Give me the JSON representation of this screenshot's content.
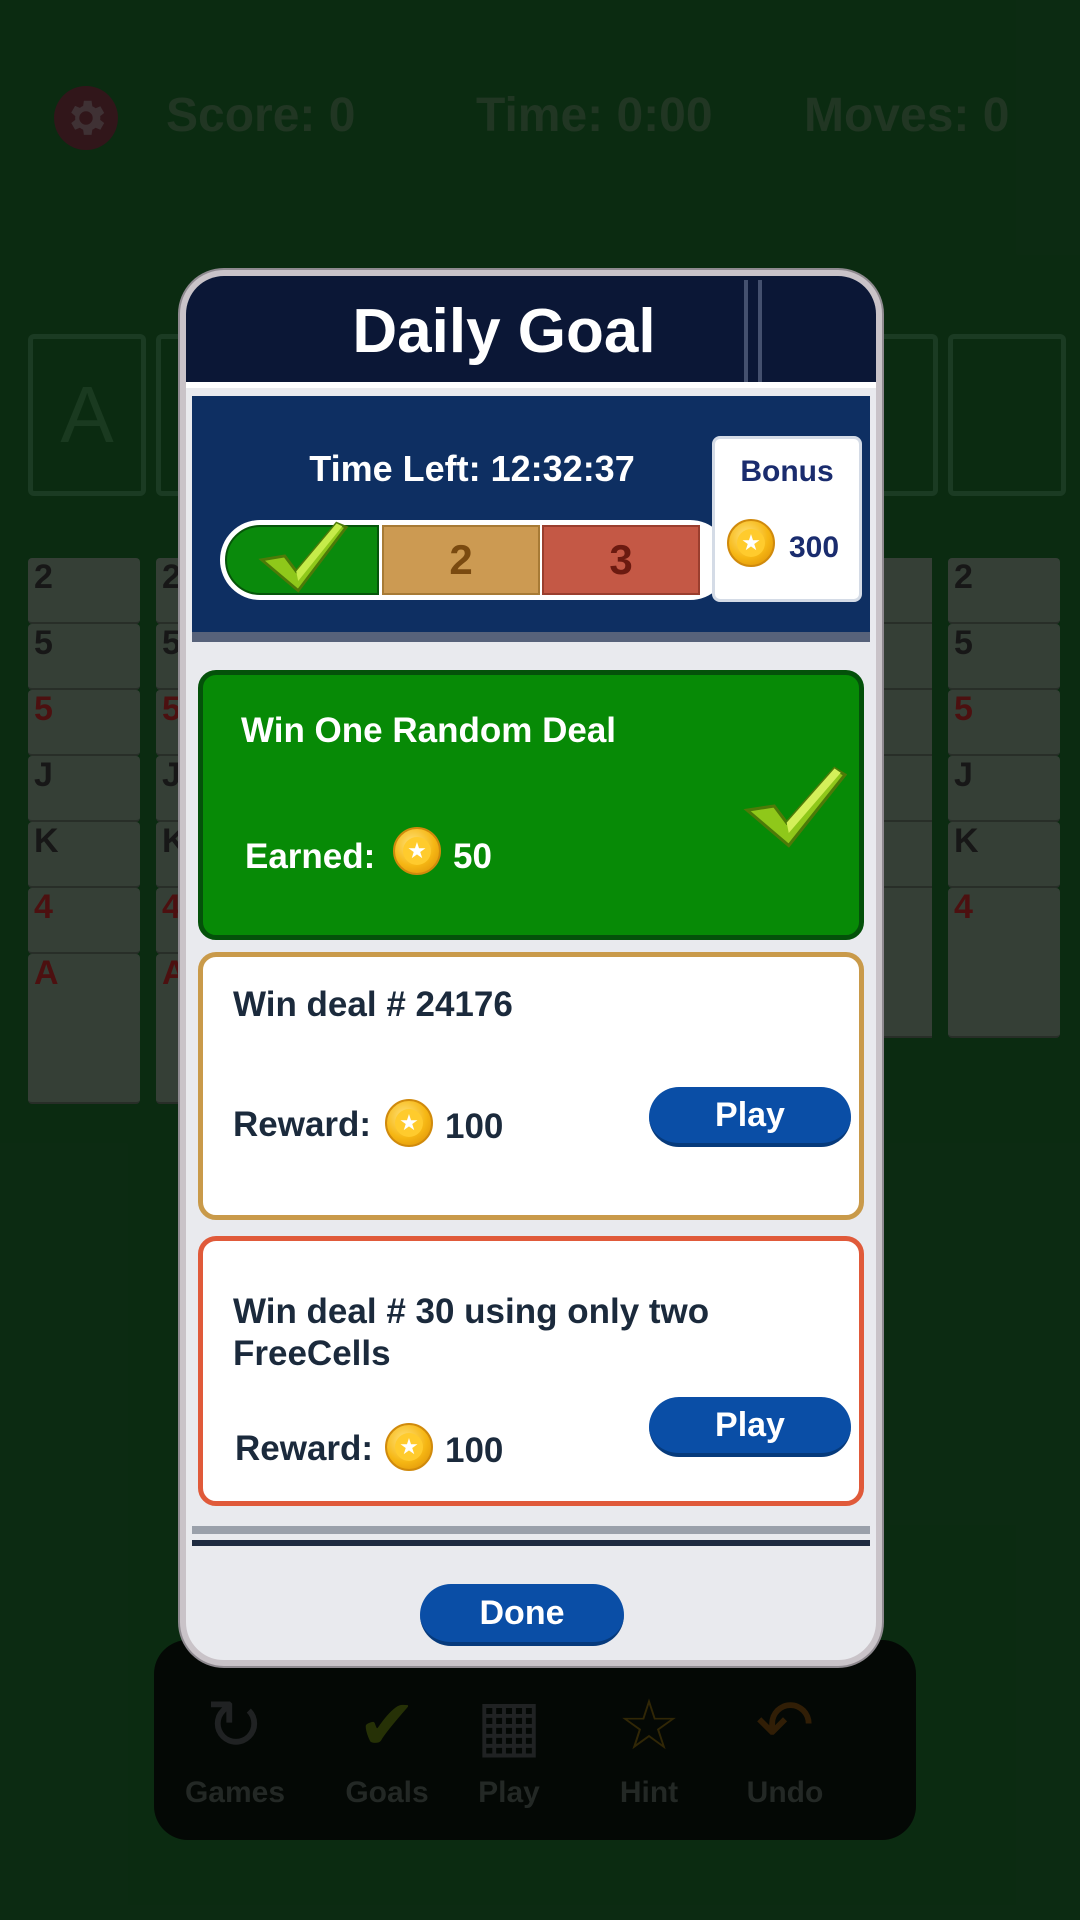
{
  "background": {
    "stats": {
      "score": "Score: 0",
      "time": "Time: 0:00",
      "moves": "Moves: 0"
    },
    "foundation_letter": "A",
    "toolbar": [
      {
        "label": "Games",
        "icon": "refresh-icon"
      },
      {
        "label": "Goals",
        "icon": "checkmark-icon"
      },
      {
        "label": "Play",
        "icon": "card-deck-icon"
      },
      {
        "label": "Hint",
        "icon": "lightbulb-icon"
      },
      {
        "label": "Undo",
        "icon": "undo-arrow-icon"
      }
    ],
    "column_cards": [
      "2",
      "5",
      "5",
      "J",
      "K",
      "4",
      "A"
    ]
  },
  "modal": {
    "title": "Daily Goal",
    "time_left": "Time Left: 12:32:37",
    "steps": [
      {
        "label": "",
        "state": "completed"
      },
      {
        "label": "2",
        "state": "pending"
      },
      {
        "label": "3",
        "state": "pending"
      }
    ],
    "bonus": {
      "label": "Bonus",
      "amount": "300"
    },
    "goals": [
      {
        "title": "Win One Random Deal",
        "reward_label": "Earned:",
        "amount": "50",
        "completed": true
      },
      {
        "title": "Win deal # 24176",
        "reward_label": "Reward:",
        "amount": "100",
        "button": "Play"
      },
      {
        "title": "Win deal # 30 using only two FreeCells",
        "reward_label": "Reward:",
        "amount": "100",
        "button": "Play"
      }
    ],
    "done_label": "Done"
  },
  "colors": {
    "modal_header": "#0b1736",
    "progress_panel": "#0e2f62",
    "goal_complete": "#078a06",
    "goal2_border": "#c99a4a",
    "goal3_border": "#e05a3a",
    "button": "#0a4ea6"
  }
}
